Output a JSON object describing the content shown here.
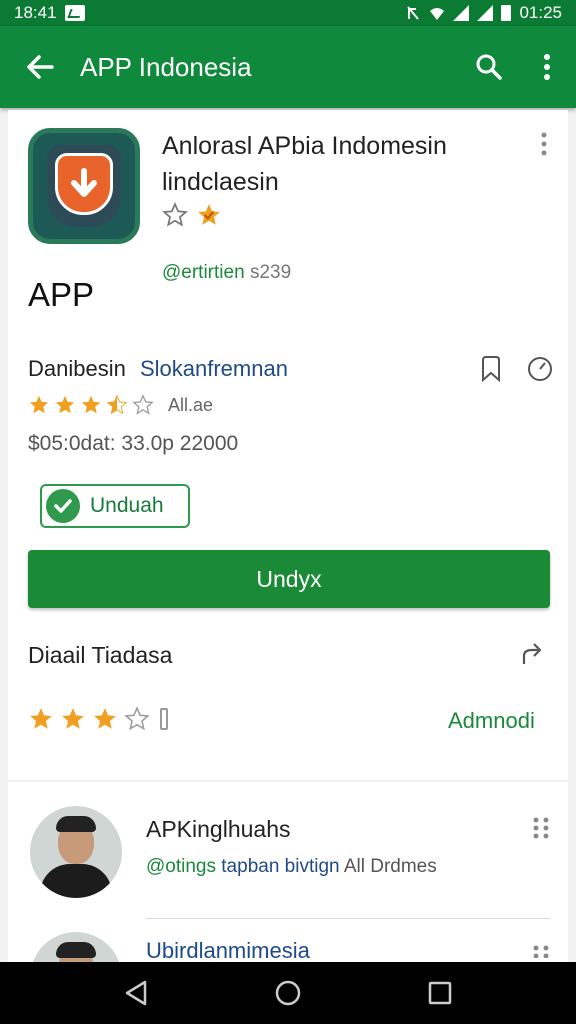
{
  "status_bar": {
    "time_left": "18:41",
    "time_right": "01:25"
  },
  "app_bar": {
    "title": "APP Indonesia"
  },
  "app": {
    "name": "Anlorasl APbia Indomesin lindclaesin",
    "label": "APP",
    "developer": "@ertirtien",
    "developer_suffix": "s239"
  },
  "category": {
    "primary": "Danibesin",
    "secondary": "Slokanfremnan"
  },
  "rating": {
    "count_text": "All.ae",
    "stars_filled": 3.5,
    "stars_total": 5
  },
  "info_line": "$05:0dat: 33.0p 22000",
  "chip": {
    "label": "Unduah"
  },
  "install_button": {
    "label": "Undyx"
  },
  "details": {
    "title": "Diaail Tiadasa",
    "link": "Admnodi",
    "stars_filled": 3,
    "stars_total": 5
  },
  "reviews": [
    {
      "name": "APKinglhuahs",
      "sub_green": "@otings",
      "sub_blue": "tapban bivtign",
      "sub_gray": "All Drdmes"
    },
    {
      "name": "Ubirdlanmimesia"
    }
  ],
  "colors": {
    "accent": "#0f8a3c",
    "star": "#f0a020",
    "link_blue": "#1f4a8a"
  }
}
